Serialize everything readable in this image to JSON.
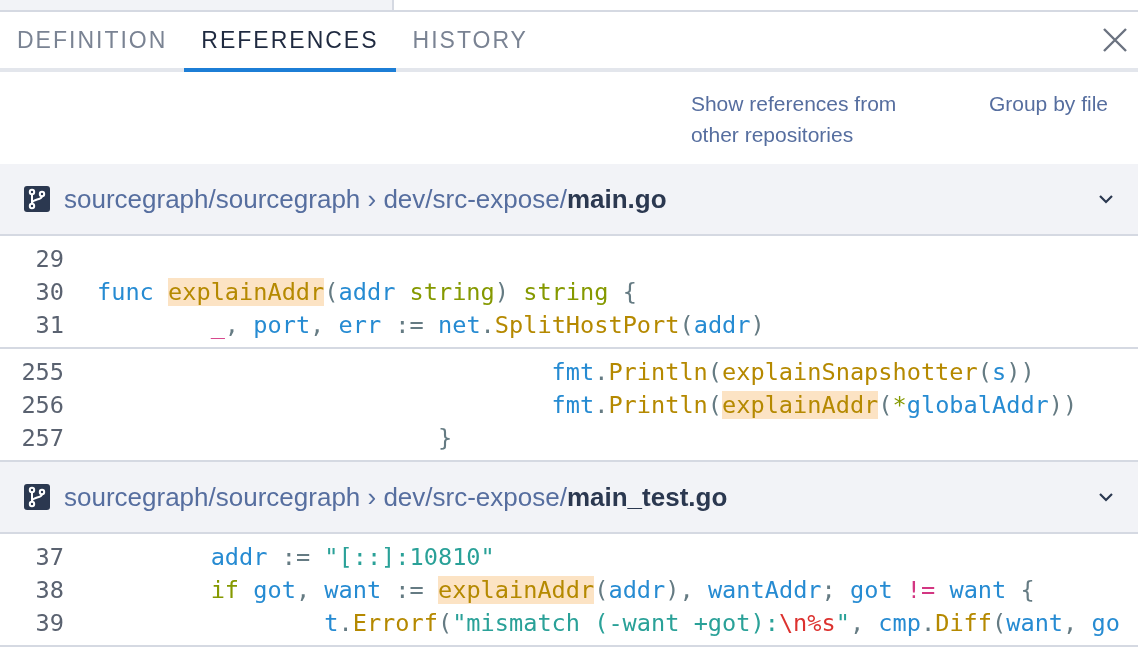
{
  "tabs": [
    {
      "label": "DEFINITION",
      "selected": false
    },
    {
      "label": "REFERENCES",
      "selected": true
    },
    {
      "label": "HISTORY",
      "selected": false
    }
  ],
  "options": [
    "Show references from other repositories",
    "Group by file"
  ],
  "files": [
    {
      "path": "sourcegraph/sourcegraph › dev/src-expose/**main.go**",
      "expanded": true,
      "groups": [
        [
          {
            "number": "29"
          },
          {
            "number": "30",
            "tokens": [
              {
                "kind": "keyword",
                "text": "func "
              },
              {
                "kind": "call",
                "text": "explainAddr",
                "highlight": true
              },
              {
                "kind": "punct",
                "text": "("
              },
              {
                "kind": "ident",
                "text": "addr "
              },
              {
                "kind": "type",
                "text": "string"
              },
              {
                "kind": "punct",
                "text": ") "
              },
              {
                "kind": "type",
                "text": "string"
              },
              {
                "kind": "punct",
                "text": " {"
              }
            ]
          },
          {
            "number": "31",
            "tokens": [
              {
                "kind": "special",
                "text": "        _"
              },
              {
                "kind": "punct",
                "text": ", "
              },
              {
                "kind": "ident",
                "text": "port"
              },
              {
                "kind": "punct",
                "text": ", "
              },
              {
                "kind": "ident",
                "text": "err"
              },
              {
                "kind": "punct",
                "text": " := "
              },
              {
                "kind": "ident",
                "text": "net"
              },
              {
                "kind": "punct",
                "text": "."
              },
              {
                "kind": "call",
                "text": "SplitHostPort"
              },
              {
                "kind": "punct",
                "text": "("
              },
              {
                "kind": "ident",
                "text": "addr"
              },
              {
                "kind": "punct",
                "text": ")"
              }
            ]
          }
        ],
        [
          {
            "number": "255",
            "tokens": [
              {
                "kind": "ident",
                "text": "                                fmt"
              },
              {
                "kind": "punct",
                "text": "."
              },
              {
                "kind": "call",
                "text": "Println"
              },
              {
                "kind": "punct",
                "text": "("
              },
              {
                "kind": "call",
                "text": "explainSnapshotter"
              },
              {
                "kind": "punct",
                "text": "("
              },
              {
                "kind": "ident",
                "text": "s"
              },
              {
                "kind": "punct",
                "text": "))"
              }
            ]
          },
          {
            "number": "256",
            "tokens": [
              {
                "kind": "ident",
                "text": "                                fmt"
              },
              {
                "kind": "punct",
                "text": "."
              },
              {
                "kind": "call",
                "text": "Println"
              },
              {
                "kind": "punct",
                "text": "("
              },
              {
                "kind": "call",
                "text": "explainAddr",
                "highlight": true
              },
              {
                "kind": "punct",
                "text": "("
              },
              {
                "kind": "type",
                "text": "*"
              },
              {
                "kind": "ident",
                "text": "globalAddr"
              },
              {
                "kind": "punct",
                "text": "))"
              }
            ]
          },
          {
            "number": "257",
            "tokens": [
              {
                "kind": "punct",
                "text": "                        }"
              }
            ]
          }
        ]
      ]
    },
    {
      "path": "sourcegraph/sourcegraph › dev/src-expose/**main_test.go**",
      "expanded": true,
      "groups": [
        [
          {
            "number": "37",
            "tokens": [
              {
                "kind": "ident",
                "text": "        addr"
              },
              {
                "kind": "punct",
                "text": " := "
              },
              {
                "kind": "string",
                "text": "\"[::]:10810\""
              }
            ]
          },
          {
            "number": "38",
            "tokens": [
              {
                "kind": "type",
                "text": "        if "
              },
              {
                "kind": "ident",
                "text": "got"
              },
              {
                "kind": "punct",
                "text": ", "
              },
              {
                "kind": "ident",
                "text": "want"
              },
              {
                "kind": "punct",
                "text": " := "
              },
              {
                "kind": "call",
                "text": "explainAddr",
                "highlight": true
              },
              {
                "kind": "punct",
                "text": "("
              },
              {
                "kind": "ident",
                "text": "addr"
              },
              {
                "kind": "punct",
                "text": "), "
              },
              {
                "kind": "ident",
                "text": "wantAddr"
              },
              {
                "kind": "punct",
                "text": "; "
              },
              {
                "kind": "ident",
                "text": "got "
              },
              {
                "kind": "special",
                "text": "!="
              },
              {
                "kind": "ident",
                "text": " want"
              },
              {
                "kind": "punct",
                "text": " {"
              }
            ]
          },
          {
            "number": "39",
            "tokens": [
              {
                "kind": "ident",
                "text": "                t"
              },
              {
                "kind": "punct",
                "text": "."
              },
              {
                "kind": "call",
                "text": "Errorf"
              },
              {
                "kind": "punct",
                "text": "("
              },
              {
                "kind": "string",
                "text": "\"mismatch (-want +got):"
              },
              {
                "kind": "escape",
                "text": "\\n%s"
              },
              {
                "kind": "string",
                "text": "\""
              },
              {
                "kind": "punct",
                "text": ", "
              },
              {
                "kind": "ident",
                "text": "cmp"
              },
              {
                "kind": "punct",
                "text": "."
              },
              {
                "kind": "call",
                "text": "Diff"
              },
              {
                "kind": "punct",
                "text": "("
              },
              {
                "kind": "ident",
                "text": "want"
              },
              {
                "kind": "punct",
                "text": ", "
              },
              {
                "kind": "ident",
                "text": "go"
              }
            ]
          }
        ]
      ]
    }
  ]
}
